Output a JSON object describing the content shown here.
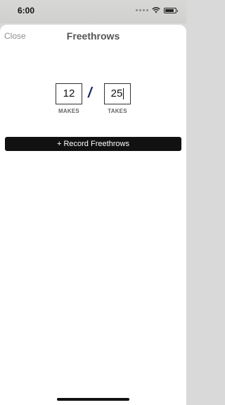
{
  "status_bar": {
    "time": "6:00",
    "icons": [
      "signal-dots-icon",
      "wifi-icon",
      "battery-icon"
    ]
  },
  "nav": {
    "close_label": "Close",
    "title": "Freethrows"
  },
  "form": {
    "makes_value": "12",
    "makes_label": "MAKES",
    "separator": "/",
    "takes_value": "25",
    "takes_label": "TAKES"
  },
  "record_button": {
    "label": "+ Record Freethrows"
  },
  "colors": {
    "accent": "#1a2a66",
    "button_bg": "#111111",
    "button_text": "#ffffff",
    "muted_text": "#8f8f8f"
  }
}
